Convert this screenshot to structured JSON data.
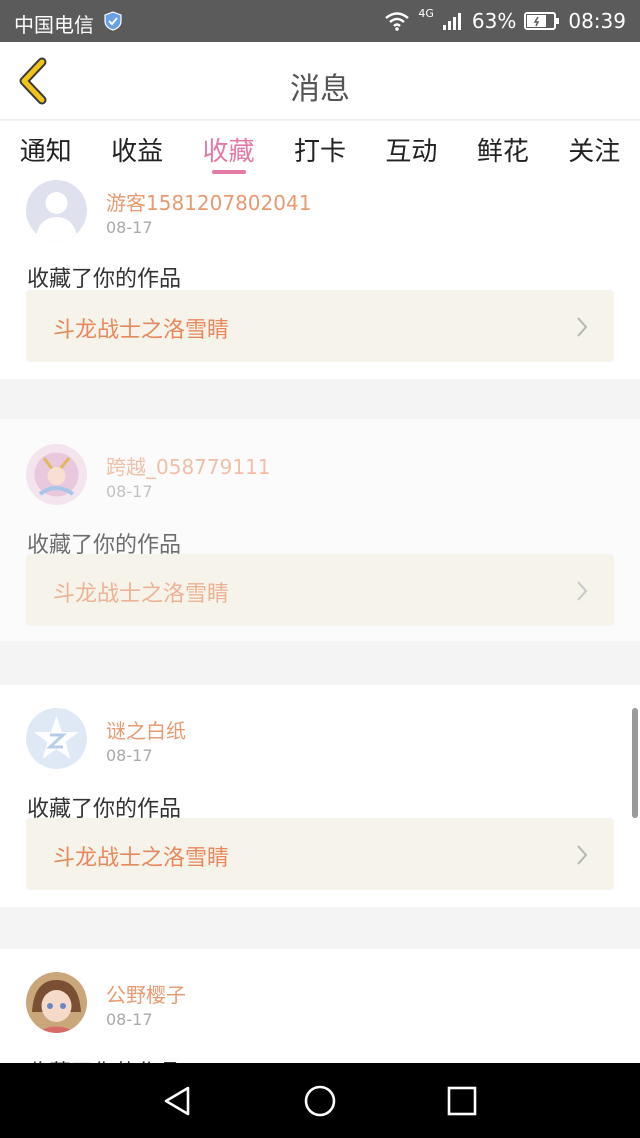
{
  "status_bar": {
    "carrier": "中国电信",
    "network": "4G",
    "battery": "63%",
    "time": "08:39"
  },
  "header": {
    "title": "消息"
  },
  "tabs": [
    {
      "label": "通知"
    },
    {
      "label": "收益"
    },
    {
      "label": "收藏",
      "active": true
    },
    {
      "label": "打卡"
    },
    {
      "label": "互动"
    },
    {
      "label": "鲜花"
    },
    {
      "label": "关注"
    }
  ],
  "items": [
    {
      "user": "游客1581207802041",
      "date": "08-17",
      "message": "收藏了你的作品",
      "work": "斗龙战士之洛雪睛"
    },
    {
      "user": "跨越_058779111",
      "date": "08-17",
      "message": "收藏了你的作品",
      "work": "斗龙战士之洛雪睛"
    },
    {
      "user": "谜之白纸",
      "date": "08-17",
      "message": "收藏了你的作品",
      "work": "斗龙战士之洛雪睛"
    },
    {
      "user": "公野樱子",
      "date": "08-17",
      "message": "收藏了你的作品"
    }
  ],
  "colors": {
    "accent": "#e57aa6",
    "username": "#e89a71",
    "work_title": "#e8895d"
  }
}
